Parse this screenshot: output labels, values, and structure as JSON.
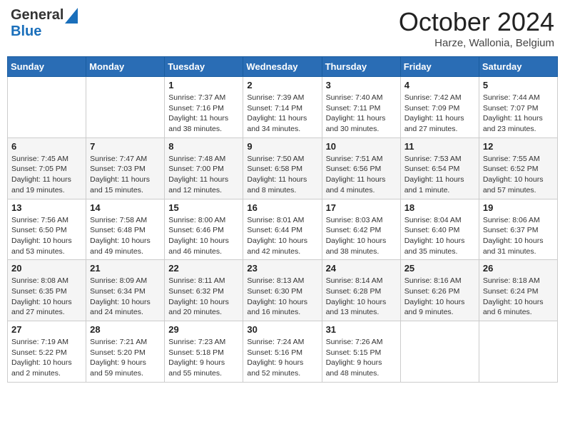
{
  "header": {
    "logo_general": "General",
    "logo_blue": "Blue",
    "month": "October 2024",
    "location": "Harze, Wallonia, Belgium"
  },
  "days_of_week": [
    "Sunday",
    "Monday",
    "Tuesday",
    "Wednesday",
    "Thursday",
    "Friday",
    "Saturday"
  ],
  "weeks": [
    [
      {
        "day": "",
        "info": ""
      },
      {
        "day": "",
        "info": ""
      },
      {
        "day": "1",
        "info": "Sunrise: 7:37 AM\nSunset: 7:16 PM\nDaylight: 11 hours and 38 minutes."
      },
      {
        "day": "2",
        "info": "Sunrise: 7:39 AM\nSunset: 7:14 PM\nDaylight: 11 hours and 34 minutes."
      },
      {
        "day": "3",
        "info": "Sunrise: 7:40 AM\nSunset: 7:11 PM\nDaylight: 11 hours and 30 minutes."
      },
      {
        "day": "4",
        "info": "Sunrise: 7:42 AM\nSunset: 7:09 PM\nDaylight: 11 hours and 27 minutes."
      },
      {
        "day": "5",
        "info": "Sunrise: 7:44 AM\nSunset: 7:07 PM\nDaylight: 11 hours and 23 minutes."
      }
    ],
    [
      {
        "day": "6",
        "info": "Sunrise: 7:45 AM\nSunset: 7:05 PM\nDaylight: 11 hours and 19 minutes."
      },
      {
        "day": "7",
        "info": "Sunrise: 7:47 AM\nSunset: 7:03 PM\nDaylight: 11 hours and 15 minutes."
      },
      {
        "day": "8",
        "info": "Sunrise: 7:48 AM\nSunset: 7:00 PM\nDaylight: 11 hours and 12 minutes."
      },
      {
        "day": "9",
        "info": "Sunrise: 7:50 AM\nSunset: 6:58 PM\nDaylight: 11 hours and 8 minutes."
      },
      {
        "day": "10",
        "info": "Sunrise: 7:51 AM\nSunset: 6:56 PM\nDaylight: 11 hours and 4 minutes."
      },
      {
        "day": "11",
        "info": "Sunrise: 7:53 AM\nSunset: 6:54 PM\nDaylight: 11 hours and 1 minute."
      },
      {
        "day": "12",
        "info": "Sunrise: 7:55 AM\nSunset: 6:52 PM\nDaylight: 10 hours and 57 minutes."
      }
    ],
    [
      {
        "day": "13",
        "info": "Sunrise: 7:56 AM\nSunset: 6:50 PM\nDaylight: 10 hours and 53 minutes."
      },
      {
        "day": "14",
        "info": "Sunrise: 7:58 AM\nSunset: 6:48 PM\nDaylight: 10 hours and 49 minutes."
      },
      {
        "day": "15",
        "info": "Sunrise: 8:00 AM\nSunset: 6:46 PM\nDaylight: 10 hours and 46 minutes."
      },
      {
        "day": "16",
        "info": "Sunrise: 8:01 AM\nSunset: 6:44 PM\nDaylight: 10 hours and 42 minutes."
      },
      {
        "day": "17",
        "info": "Sunrise: 8:03 AM\nSunset: 6:42 PM\nDaylight: 10 hours and 38 minutes."
      },
      {
        "day": "18",
        "info": "Sunrise: 8:04 AM\nSunset: 6:40 PM\nDaylight: 10 hours and 35 minutes."
      },
      {
        "day": "19",
        "info": "Sunrise: 8:06 AM\nSunset: 6:37 PM\nDaylight: 10 hours and 31 minutes."
      }
    ],
    [
      {
        "day": "20",
        "info": "Sunrise: 8:08 AM\nSunset: 6:35 PM\nDaylight: 10 hours and 27 minutes."
      },
      {
        "day": "21",
        "info": "Sunrise: 8:09 AM\nSunset: 6:34 PM\nDaylight: 10 hours and 24 minutes."
      },
      {
        "day": "22",
        "info": "Sunrise: 8:11 AM\nSunset: 6:32 PM\nDaylight: 10 hours and 20 minutes."
      },
      {
        "day": "23",
        "info": "Sunrise: 8:13 AM\nSunset: 6:30 PM\nDaylight: 10 hours and 16 minutes."
      },
      {
        "day": "24",
        "info": "Sunrise: 8:14 AM\nSunset: 6:28 PM\nDaylight: 10 hours and 13 minutes."
      },
      {
        "day": "25",
        "info": "Sunrise: 8:16 AM\nSunset: 6:26 PM\nDaylight: 10 hours and 9 minutes."
      },
      {
        "day": "26",
        "info": "Sunrise: 8:18 AM\nSunset: 6:24 PM\nDaylight: 10 hours and 6 minutes."
      }
    ],
    [
      {
        "day": "27",
        "info": "Sunrise: 7:19 AM\nSunset: 5:22 PM\nDaylight: 10 hours and 2 minutes."
      },
      {
        "day": "28",
        "info": "Sunrise: 7:21 AM\nSunset: 5:20 PM\nDaylight: 9 hours and 59 minutes."
      },
      {
        "day": "29",
        "info": "Sunrise: 7:23 AM\nSunset: 5:18 PM\nDaylight: 9 hours and 55 minutes."
      },
      {
        "day": "30",
        "info": "Sunrise: 7:24 AM\nSunset: 5:16 PM\nDaylight: 9 hours and 52 minutes."
      },
      {
        "day": "31",
        "info": "Sunrise: 7:26 AM\nSunset: 5:15 PM\nDaylight: 9 hours and 48 minutes."
      },
      {
        "day": "",
        "info": ""
      },
      {
        "day": "",
        "info": ""
      }
    ]
  ]
}
